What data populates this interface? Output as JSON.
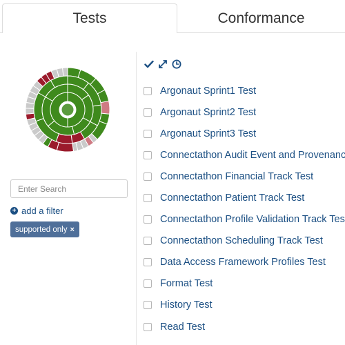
{
  "tabs": [
    {
      "label": "Tests",
      "active": true
    },
    {
      "label": "Conformance",
      "active": false
    }
  ],
  "colors": {
    "pass": "#3f8a1d",
    "pass_center": "#5a9b3c",
    "fail": "#9b1b2c",
    "fail_light": "#cf7a83",
    "skip": "#cacaca",
    "link": "#1b4f83",
    "badge": "#4f6f99"
  },
  "search": {
    "placeholder": "Enter Search"
  },
  "add_filter": {
    "label": "add a filter",
    "icon": "plus-circle-icon"
  },
  "filter_badge": {
    "label": "supported only",
    "remove_icon": "×"
  },
  "toolbar": {
    "icons": [
      "check-icon",
      "expand-icon",
      "clock-icon"
    ]
  },
  "tests": [
    "Argonaut Sprint1 Test",
    "Argonaut Sprint2 Test",
    "Argonaut Sprint3 Test",
    "Connectathon Audit Event and Provenance Tracks",
    "Connectathon Financial Track Test",
    "Connectathon Patient Track Test",
    "Connectathon Profile Validation Track Test",
    "Connectathon Scheduling Track Test",
    "Data Access Framework Profiles Test",
    "Format Test",
    "History Test",
    "Read Test"
  ]
}
